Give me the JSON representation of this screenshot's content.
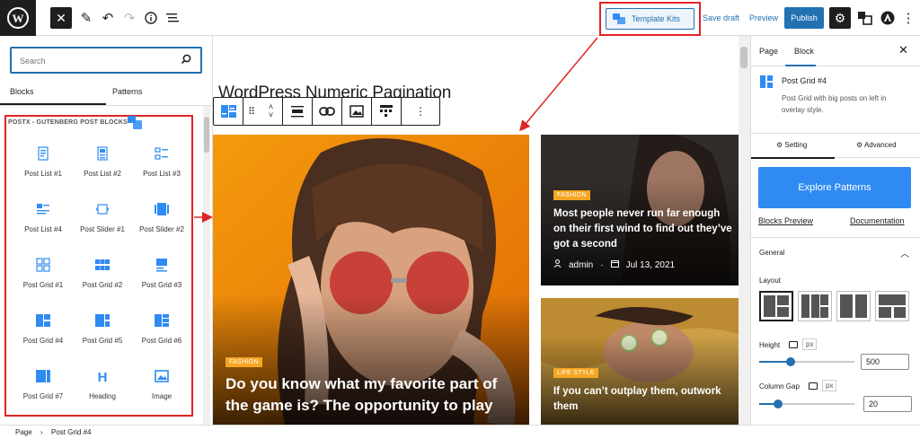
{
  "topbar": {
    "template_kits_label": "Template Kits",
    "save_draft_label": "Save draft",
    "preview_label": "Preview",
    "publish_label": "Publish"
  },
  "inserter": {
    "search_placeholder": "Search",
    "tabs": [
      "Blocks",
      "Patterns"
    ],
    "category_title": "POSTX - GUTENBERG POST BLOCKS",
    "blocks": [
      {
        "label": "Post List #1",
        "icon": "post-list-1-icon"
      },
      {
        "label": "Post List #2",
        "icon": "post-list-2-icon"
      },
      {
        "label": "Post List #3",
        "icon": "post-list-3-icon"
      },
      {
        "label": "Post List #4",
        "icon": "post-list-4-icon"
      },
      {
        "label": "Post Slider #1",
        "icon": "post-slider-1-icon"
      },
      {
        "label": "Post Slider #2",
        "icon": "post-slider-2-icon"
      },
      {
        "label": "Post Grid #1",
        "icon": "post-grid-1-icon"
      },
      {
        "label": "Post Grid #2",
        "icon": "post-grid-2-icon"
      },
      {
        "label": "Post Grid #3",
        "icon": "post-grid-3-icon"
      },
      {
        "label": "Post Grid #4",
        "icon": "post-grid-4-icon"
      },
      {
        "label": "Post Grid #5",
        "icon": "post-grid-5-icon"
      },
      {
        "label": "Post Grid #6",
        "icon": "post-grid-6-icon"
      },
      {
        "label": "Post Grid #7",
        "icon": "post-grid-7-icon"
      },
      {
        "label": "Heading",
        "icon": "heading-icon"
      },
      {
        "label": "Image",
        "icon": "image-icon"
      }
    ]
  },
  "canvas": {
    "page_title": "WordPress Numeric Pagination",
    "posts": [
      {
        "tag": "FASHION",
        "title": "Do you know what my favorite part of the game is? The opportunity to play"
      },
      {
        "tag": "FASHION",
        "title": "Most people never run far enough on their first wind to find out they’ve got a second",
        "author": "admin",
        "date": "Jul 13, 2021"
      },
      {
        "tag": "LIFE STYLE",
        "title": "If you can’t outplay them, outwork them"
      }
    ]
  },
  "sidebar": {
    "tabs": [
      "Page",
      "Block"
    ],
    "block_name": "Post Grid #4",
    "block_desc": "Post Grid with big posts on left in overlay style.",
    "subtabs": [
      "Setting",
      "Advanced"
    ],
    "explore_label": "Explore Patterns",
    "blocks_preview_label": "Blocks Preview",
    "documentation_label": "Documentation",
    "section_title": "General",
    "layout_label": "Layout",
    "height_label": "Height",
    "height_unit": "px",
    "height_value": "500",
    "height_fraction": 0.33,
    "gap_label": "Column Gap",
    "gap_unit": "px",
    "gap_value": "20",
    "gap_fraction": 0.2
  },
  "footer": {
    "breadcrumb": [
      "Page",
      "Post Grid #4"
    ]
  },
  "colors": {
    "accent": "#2271b1",
    "postx_blue": "#2f8bf2",
    "highlight_red": "#e02424",
    "tag_orange": "#f6a623"
  }
}
